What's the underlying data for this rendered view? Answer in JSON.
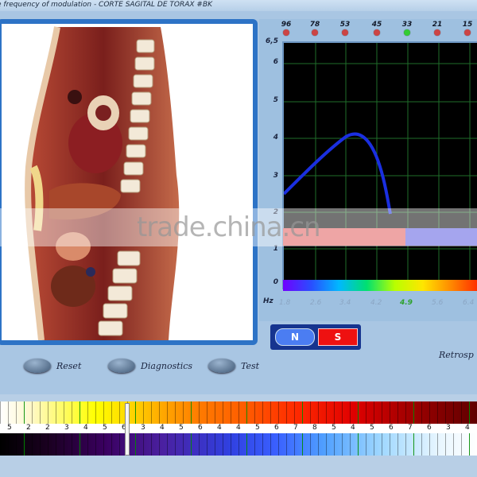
{
  "window": {
    "title": "e frequency of modulation - CORTE SAGITAL DE TORAX #BK"
  },
  "markers": [
    {
      "value": "96",
      "color": "red"
    },
    {
      "value": "78",
      "color": "red"
    },
    {
      "value": "53",
      "color": "red"
    },
    {
      "value": "45",
      "color": "red"
    },
    {
      "value": "33",
      "color": "green"
    },
    {
      "value": "21",
      "color": "red"
    },
    {
      "value": "15",
      "color": "red"
    }
  ],
  "graph": {
    "y_ticks": [
      "6,5",
      "6",
      "5",
      "4",
      "3",
      "2",
      "1",
      "0"
    ],
    "x_ticks": [
      "1.8",
      "2.6",
      "3.4",
      "4.2",
      "4.9",
      "5.6",
      "6.4"
    ],
    "active_x_tick": "4.9",
    "x_unit_label": "Hz",
    "curve_color": "#1a2fe0"
  },
  "ns_switch": {
    "n_label": "N",
    "s_label": "S"
  },
  "controls": {
    "reset_label": "Reset",
    "diagnostics_label": "Diagnostics",
    "test_label": "Test"
  },
  "retro_label": "Retrosp",
  "watermark": "trade.china.cn",
  "frequency_scale": {
    "numbers": [
      "5",
      "2",
      "2",
      "3",
      "4",
      "5",
      "6",
      "3",
      "4",
      "5",
      "6",
      "4",
      "4",
      "5",
      "6",
      "7",
      "8",
      "5",
      "4",
      "5",
      "6",
      "7",
      "6",
      "3",
      "4"
    ]
  }
}
